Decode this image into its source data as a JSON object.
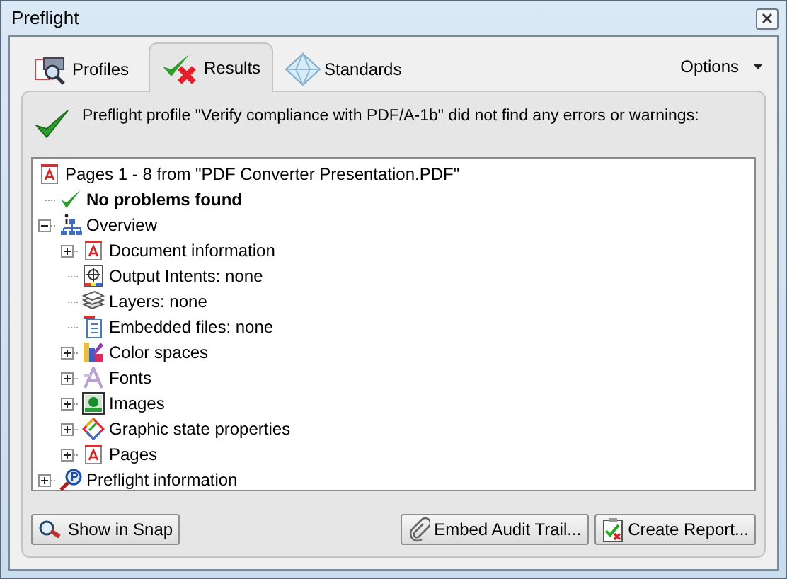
{
  "window": {
    "title": "Preflight"
  },
  "tabs": [
    {
      "label": "Profiles",
      "kind": "profiles",
      "selected": false
    },
    {
      "label": "Results",
      "kind": "results",
      "selected": true
    },
    {
      "label": "Standards",
      "kind": "standards",
      "selected": false
    }
  ],
  "options_menu": {
    "label": "Options"
  },
  "message": "Preflight profile \"Verify compliance with PDF/A-1b\" did not find any errors or warnings:",
  "tree": {
    "label": "Pages 1 - 8 from \"PDF Converter Presentation.PDF\"",
    "kind": "pdf",
    "children": [
      {
        "label": "No problems found",
        "kind": "ok"
      },
      {
        "label": "Overview",
        "kind": "hierarchy",
        "expanded": true,
        "children": [
          {
            "label": "Document information",
            "kind": "pdf",
            "expanded": false
          },
          {
            "label": "Output Intents: none",
            "kind": "output"
          },
          {
            "label": "Layers: none",
            "kind": "layers"
          },
          {
            "label": "Embedded files: none",
            "kind": "file"
          },
          {
            "label": "Color spaces",
            "kind": "colors",
            "expanded": false
          },
          {
            "label": "Fonts",
            "kind": "fonts",
            "expanded": false
          },
          {
            "label": "Images",
            "kind": "image",
            "expanded": false
          },
          {
            "label": "Graphic state properties",
            "kind": "graphic",
            "expanded": false
          },
          {
            "label": "Pages",
            "kind": "pdf",
            "expanded": false
          }
        ]
      },
      {
        "label": "Preflight information",
        "kind": "preflight",
        "expanded": false
      }
    ]
  },
  "buttons": [
    {
      "label": "Show in Snap",
      "kind": "snap"
    },
    {
      "label": "Embed Audit Trail...",
      "kind": "clip"
    },
    {
      "label": "Create Report...",
      "kind": "report"
    }
  ]
}
